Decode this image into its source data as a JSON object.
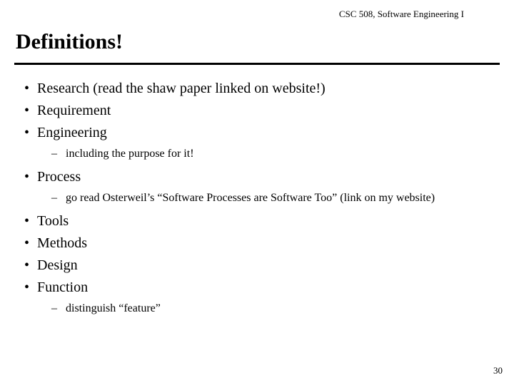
{
  "header": "CSC 508, Software Engineering I",
  "title": "Definitions!",
  "bullets": {
    "b0": "Research (read the shaw paper linked on website!)",
    "b1": "Requirement",
    "b2": "Engineering",
    "b2_sub0": "including the purpose for it!",
    "b3": "Process",
    "b3_sub0": "go read Osterweil’s “Software Processes are Software Too” (link on my website)",
    "b4": "Tools",
    "b5": "Methods",
    "b6": "Design",
    "b7": "Function",
    "b7_sub0": "distinguish “feature”"
  },
  "page_number": "30"
}
